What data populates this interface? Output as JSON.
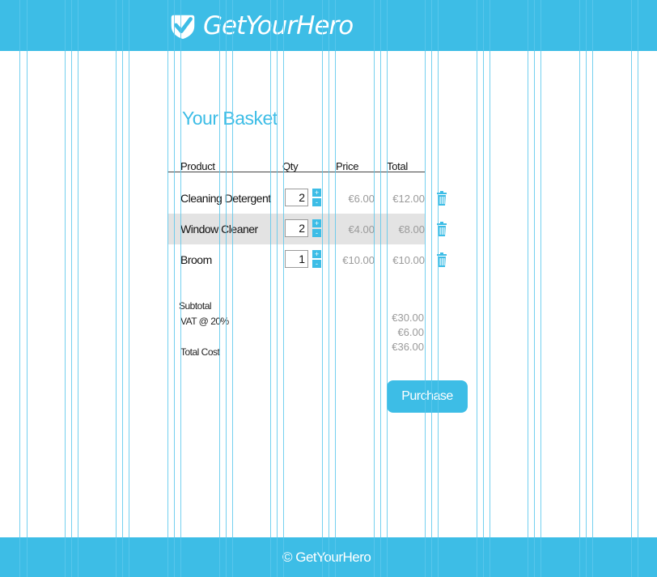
{
  "brand": {
    "name": "GetYourHero",
    "footer": "© GetYourHero"
  },
  "colors": {
    "accent": "#3dbde6",
    "row_highlight": "#e3e3e3",
    "muted_text": "#9a9a9a"
  },
  "basket": {
    "title": "Your Basket",
    "columns": {
      "product": "Product",
      "qty": "Qty",
      "price": "Price",
      "total": "Total"
    },
    "items": [
      {
        "name": "Cleaning Detergent",
        "qty": "2",
        "price": "€6.00",
        "total": "€12.00"
      },
      {
        "name": "Window Cleaner",
        "qty": "2",
        "price": "€4.00",
        "total": "€8.00"
      },
      {
        "name": "Broom",
        "qty": "1",
        "price": "€10.00",
        "total": "€10.00"
      }
    ],
    "stepper": {
      "plus": "+",
      "minus": "-"
    },
    "icons": {
      "remove": "trash-icon",
      "logo": "checkmark-shield-icon"
    }
  },
  "summary": {
    "subtotal_label": "Subtotal",
    "vat_label": "VAT @ 20%",
    "total_label": "Total Cost",
    "subtotal": "€30.00",
    "vat": "€6.00",
    "total": "€36.00"
  },
  "actions": {
    "purchase": "Purchase"
  }
}
